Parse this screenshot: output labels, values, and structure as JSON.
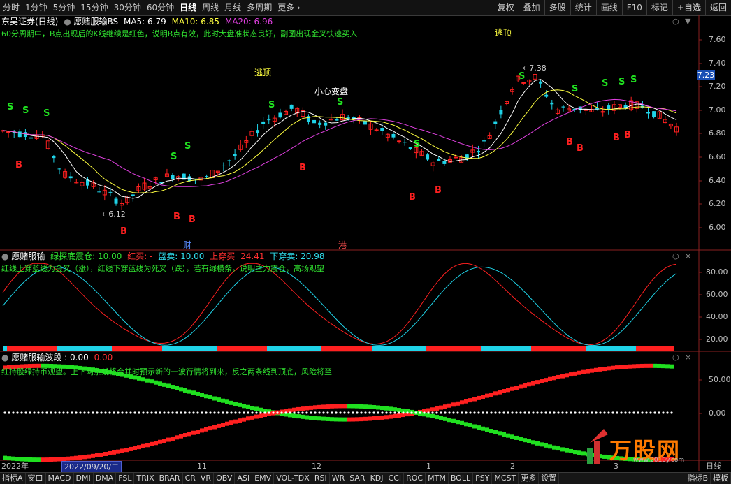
{
  "toolbar": {
    "periods": [
      "分时",
      "1分钟",
      "5分钟",
      "15分钟",
      "30分钟",
      "60分钟",
      "日线",
      "周线",
      "月线",
      "多周期",
      "更多"
    ],
    "active_period": "日线",
    "right_buttons": [
      "复权",
      "叠加",
      "多股",
      "统计",
      "画线",
      "F10",
      "标记",
      "+自选",
      "返回"
    ]
  },
  "main_panel": {
    "stock_title": "东吴证券(日线)",
    "indicator_name": "愿赌服输BS",
    "ma5": "MA5: 6.79",
    "ma10": "MA10: 6.85",
    "ma20": "MA20: 6.96",
    "description": "60分周期中，B点出现后的K线继续是红色，说明B点有效，此时大盘准状态良好，副图出现金叉快速买入",
    "annotations": {
      "escape_top_1": "逃顶",
      "escape_top_2": "逃顶",
      "careful": "小心变盘"
    },
    "high_label": "7.38",
    "low_label": "6.12",
    "event_cai": "财",
    "event_gang": "港",
    "y_ticks": [
      "7.60",
      "7.40",
      "7.20",
      "7.00",
      "6.80",
      "6.60",
      "6.40",
      "6.20",
      "6.00"
    ],
    "current_price": "7.23",
    "signal_b": "B",
    "signal_s": "S"
  },
  "sub1_panel": {
    "title": "愿赌服输",
    "green_label": "绿探底震仓: 10.00",
    "red_label": "红买: -",
    "blue_label": "蓝卖: 10.00",
    "up_cross": "上穿买",
    "up_cross_val": "24.41",
    "down_cross": "下穿卖: 20.98",
    "description": "红线上穿蓝线为金叉（涨），红线下穿蓝线为死叉（跌），若有绿横条，说明主力震仓，高场观望",
    "y_ticks": [
      "80.00",
      "60.00",
      "40.00",
      "20.00"
    ]
  },
  "sub2_panel": {
    "title": "愿赌服输波段",
    "value1": ": 0.00",
    "value2": "0.00",
    "description": "红持股绿持币观望。上下两条线将合并时预示新的一波行情将到来，反之两条线到顶底，风险将至",
    "y_ticks": [
      "50.00",
      "0.00"
    ]
  },
  "date_axis": {
    "year": "2022年",
    "selected_date": "2022/09/20/二",
    "months": [
      "11",
      "12",
      "1",
      "2",
      "3"
    ],
    "right_label": "日线"
  },
  "bottom_tabs": [
    "指标A",
    "窗口",
    "MACD",
    "DMI",
    "DMA",
    "FSL",
    "TRIX",
    "BRAR",
    "CR",
    "VR",
    "OBV",
    "ASI",
    "EMV",
    "VOL-TDX",
    "RSI",
    "WR",
    "SAR",
    "KDJ",
    "CCI",
    "ROC",
    "MTM",
    "BOLL",
    "PSY",
    "MCST",
    "更多",
    "设置"
  ],
  "bottom_right": [
    "指标B",
    "模板"
  ],
  "watermark": {
    "text": "万股网",
    "sub": "www.2010y.com"
  },
  "colors": {
    "up": "#ff2020",
    "down": "#1fd3e8",
    "ma5": "#ffffff",
    "ma10": "#ffff40",
    "ma20": "#e040e0",
    "signal_b": "#ff2020",
    "signal_s": "#20e020",
    "blue_bg": "#1a4fb5"
  }
}
